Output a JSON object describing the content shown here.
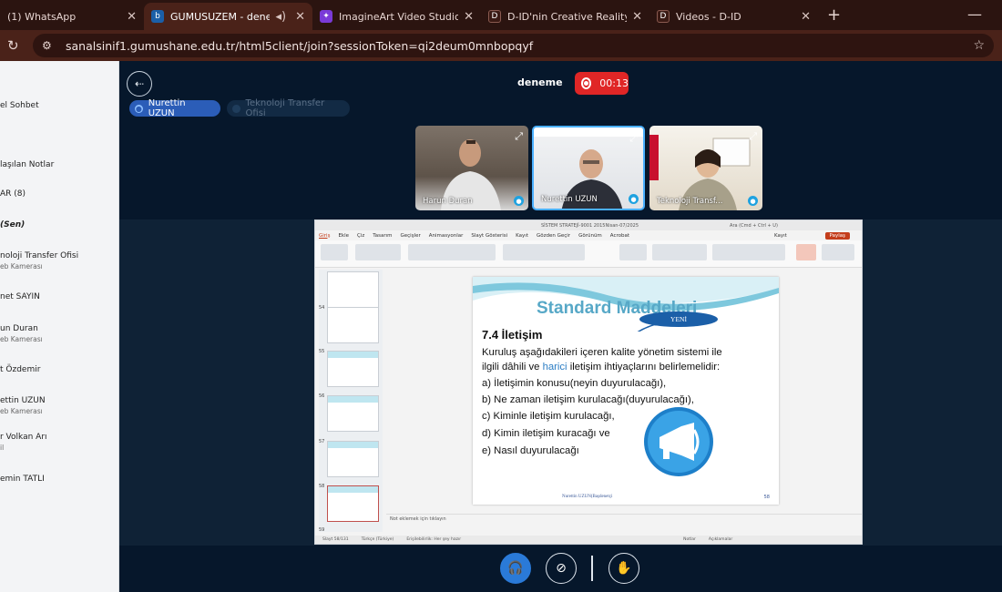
{
  "tabs": [
    {
      "title": "(1) WhatsApp",
      "favicon": "whatsapp-icon",
      "active": false
    },
    {
      "title": "GUMUSUZEM - deneme - V",
      "favicon": "bigbluebutton-icon",
      "active": true
    },
    {
      "title": "ImagineArt Video Studio",
      "favicon": "imagineart-icon",
      "active": false
    },
    {
      "title": "D-ID'nin Creative Reality™ Stüd",
      "favicon": "did-icon",
      "active": false
    },
    {
      "title": "Videos - D-ID",
      "favicon": "did-icon",
      "active": false
    }
  ],
  "address": {
    "url": "sanalsinif1.gumushane.edu.tr/html5client/join?sessionToken=qi2deum0mnbopqyf"
  },
  "sidebar": {
    "chat": "el Sohbet",
    "notes": "laşılan Notlar",
    "users_header": "AR (8)",
    "you": "(Sen)",
    "users": [
      {
        "name": "noloji Transfer Ofisi",
        "sub": "eb Kamerası"
      },
      {
        "name": "net SAYIN",
        "sub": ""
      },
      {
        "name": "un Duran",
        "sub": "eb Kamerası"
      },
      {
        "name": "t Özdemir",
        "sub": ""
      },
      {
        "name": "ettin UZUN",
        "sub": "eb Kamerası"
      },
      {
        "name": "r Volkan Arı",
        "sub": "il"
      },
      {
        "name": "emin TATLI",
        "sub": ""
      }
    ]
  },
  "meeting": {
    "title": "deneme",
    "rec_time": "00:13"
  },
  "talkers": [
    "Nurettin UZUN",
    "Teknoloji Transfer Ofisi"
  ],
  "videos": [
    {
      "name": "Harun Duran",
      "selected": false
    },
    {
      "name": "Nurettin UZUN",
      "selected": true
    },
    {
      "name": "Teknoloji Transf...",
      "selected": false
    }
  ],
  "ppt": {
    "window_title": "SİSTEM STRATEJİ-9001 2015Nisan-07/2025",
    "search": "Ara (Cmd + Ctrl + U)",
    "tabs": [
      "Giriş",
      "Ekle",
      "Çiz",
      "Tasarım",
      "Geçişler",
      "Animasyonlar",
      "Slayt Gösterisi",
      "Kayıt",
      "Gözden Geçir",
      "Görünüm",
      "Acrobat"
    ],
    "record": "Kayıt",
    "share": "Paylaş",
    "thumb_numbers": [
      "54",
      "55",
      "56",
      "57",
      "58",
      "59"
    ],
    "notes_placeholder": "Not eklemek için tıklayın",
    "status": [
      "Slayt 58/131",
      "Türkçe (Türkiye)",
      "Erişilebilirlik: Her şey hazır",
      "Notlar",
      "Açıklamalar"
    ]
  },
  "slide": {
    "heading": "Standard Maddeleri",
    "badge": "YENİ",
    "title": "7.4 İletişim",
    "line1": "Kuruluş aşağıdakileri içeren kalite yönetim sistemi ile",
    "line2a": "ilgili dâhili ve ",
    "line2b": "harici",
    "line2c": " iletişim ihtiyaçlarını belirlemelidir:",
    "items": [
      "a) İletişimin konusu(neyin duyurulacağı),",
      "b) Ne zaman iletişim kurulacağı(duyurulacağı),",
      "c) Kiminle iletişim kurulacağı,",
      "d) Kimin iletişim kuracağı ve",
      "e) Nasıl duyurulacağı"
    ],
    "footer": "Nurettin UZUN(Başdenetçi",
    "page": "58"
  },
  "colors": {
    "accent": "#2a7ad8",
    "record": "#e02626",
    "browser": "#4a2219"
  }
}
